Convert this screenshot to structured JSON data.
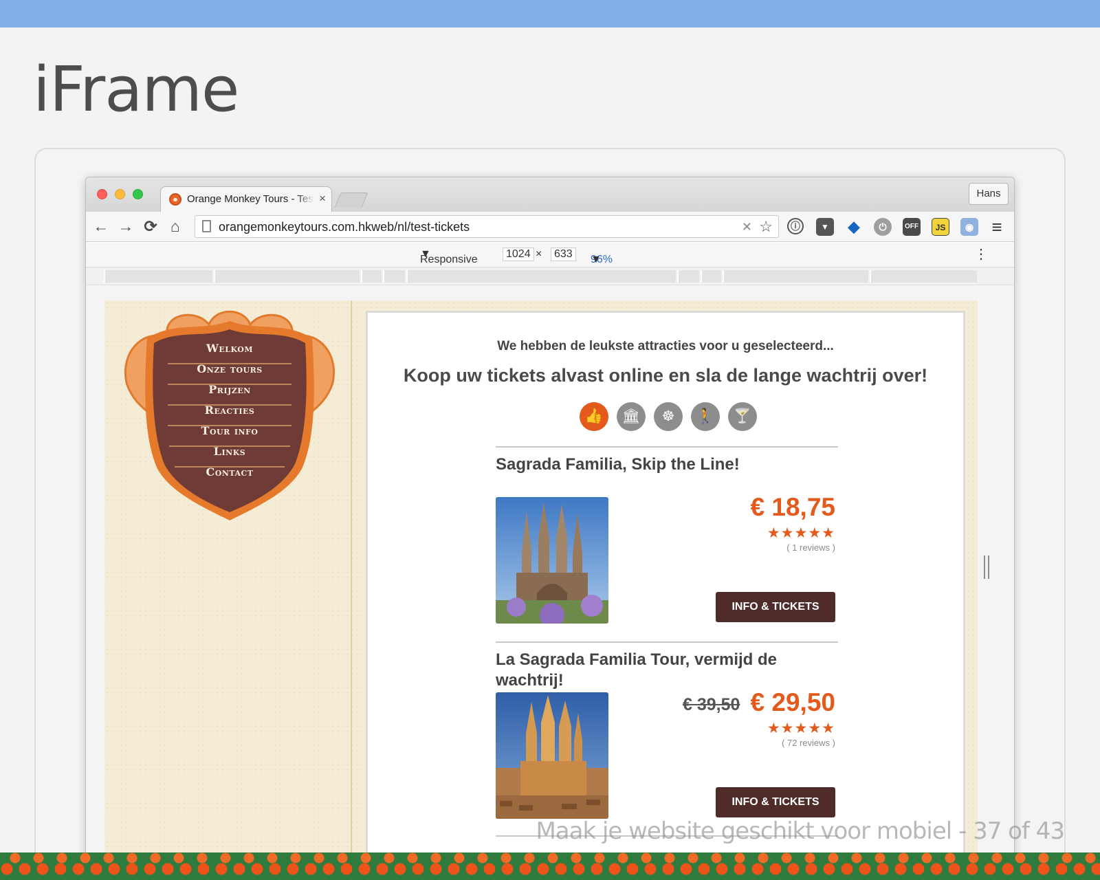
{
  "slide": {
    "title": "iFrame",
    "footer": "Maak je website geschikt voor mobiel - 37 of 43"
  },
  "browser": {
    "tab_title": "Orange Monkey Tours - Test Tickets",
    "tab_close": "×",
    "profile": "Hans",
    "nav": {
      "back": "←",
      "forward": "→",
      "reload": "⟳",
      "home": "⌂"
    },
    "url": "orangemonkeytours.com.hkweb/nl/test-tickets",
    "extensions": {
      "info": "ⓘ",
      "pocket": "▼",
      "ghostery": "◆",
      "power": "⏻",
      "off_badge": "OFF",
      "js_badge": "JS",
      "camera": "◉",
      "menu": "≡"
    }
  },
  "devtools": {
    "device": "Responsive",
    "width": "1024",
    "times": "×",
    "height": "633",
    "zoom": "96%",
    "more": "⋮"
  },
  "site": {
    "nav": [
      "Welkom",
      "Onze tours",
      "Prijzen",
      "Reacties",
      "Tour info",
      "Links",
      "Contact"
    ],
    "lead": "We hebben de leukste attracties voor u geselecteerd...",
    "headline": "Koop uw tickets alvast online en sla de lange wachtrij over!",
    "categories": [
      "👍",
      "🏛",
      "☸",
      "🚶",
      "🍸"
    ],
    "tours": [
      {
        "title": "Sagrada Familia, Skip the Line!",
        "old_price": "",
        "price": "€ 18,75",
        "stars": "★★★★★",
        "rating": 5,
        "reviews": "( 1 reviews )",
        "button": "INFO & TICKETS"
      },
      {
        "title": "La Sagrada Familia Tour, vermijd de wachtrij!",
        "old_price": "€ 39,50",
        "price": "€ 29,50",
        "stars": "★★★★★",
        "rating": 5,
        "reviews": "( 72 reviews )",
        "button": "INFO & TICKETS"
      }
    ]
  },
  "colors": {
    "top_band": "#82b0e6",
    "accent_orange": "#e45a1d",
    "button_brown": "#4f2c29",
    "shield_brown": "#6e3b36",
    "paper": "#f5ecd6"
  }
}
